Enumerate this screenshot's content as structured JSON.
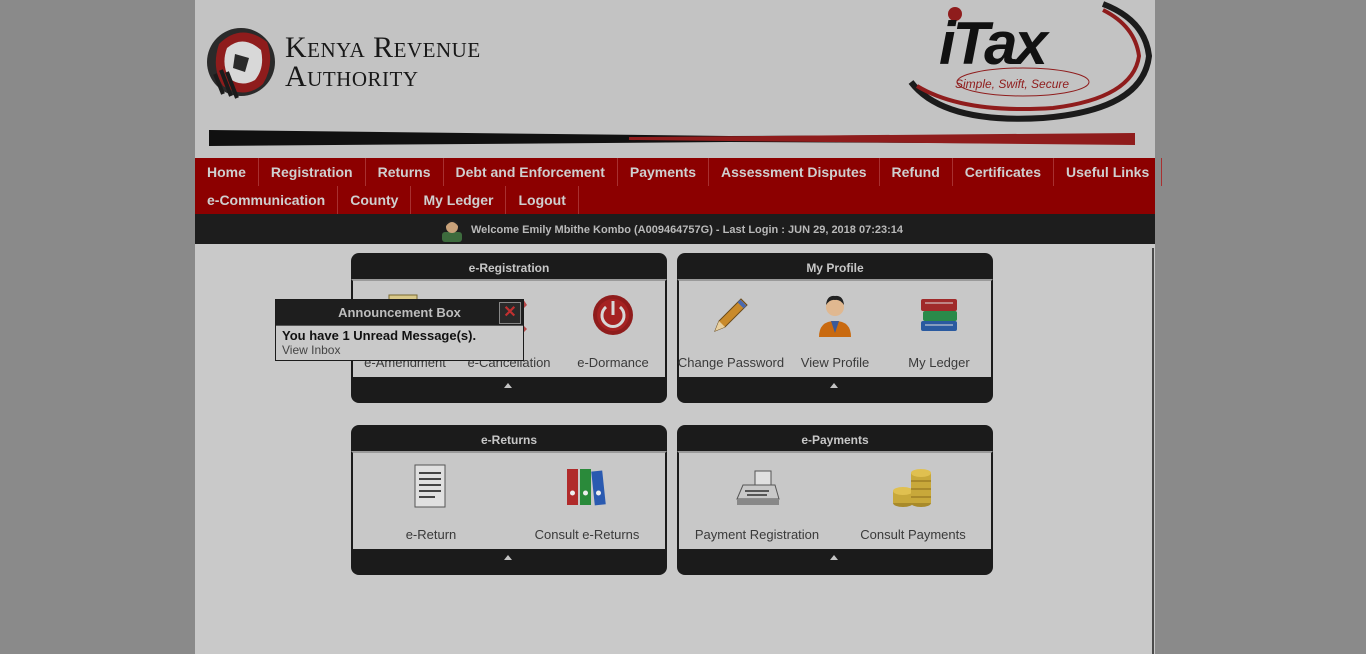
{
  "header": {
    "org_line1": "Kenya Revenue",
    "org_line2": "Authority",
    "itax_brand": "iTax",
    "itax_tagline": "Simple, Swift, Secure"
  },
  "nav": {
    "row1": [
      "Home",
      "Registration",
      "Returns",
      "Debt and Enforcement",
      "Payments",
      "Assessment Disputes",
      "Refund",
      "Certificates",
      "Useful Links"
    ],
    "row2": [
      "e-Communication",
      "County",
      "My Ledger",
      "Logout"
    ]
  },
  "welcome": "Welcome Emily Mbithe Kombo (A009464757G)  - Last Login : JUN 29, 2018 07:23:14",
  "panels": {
    "registration": {
      "title": "e-Registration",
      "items": [
        "e-Amendment",
        "e-Cancellation",
        "e-Dormance"
      ]
    },
    "profile": {
      "title": "My Profile",
      "items": [
        "Change Password",
        "View Profile",
        "My Ledger"
      ]
    },
    "returns": {
      "title": "e-Returns",
      "items": [
        "e-Return",
        "Consult e-Returns"
      ]
    },
    "payments": {
      "title": "e-Payments",
      "items": [
        "Payment Registration",
        "Consult Payments"
      ]
    }
  },
  "announcement": {
    "title": "Announcement Box",
    "message": "You have 1 Unread Message(s).",
    "link": "View Inbox",
    "close": "✕"
  },
  "colors": {
    "nav_red": "#8c0000",
    "dark_bar": "#1b1b1b",
    "overlay_gray": "#8a8a8a"
  }
}
